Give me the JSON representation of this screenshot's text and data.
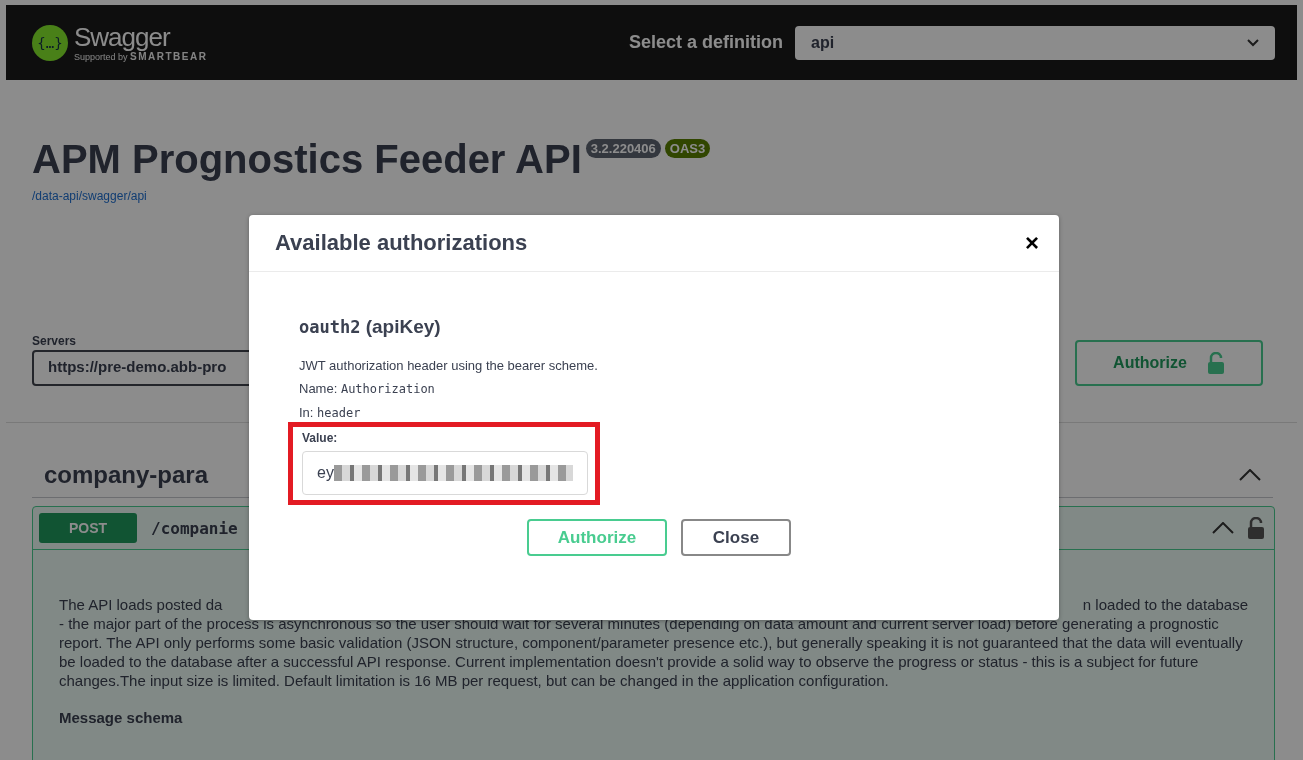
{
  "topbar": {
    "logo_glyph": "{…}",
    "logo_name": "Swagger",
    "logo_sub": "Supported by",
    "logo_brand": "SMARTBEAR",
    "definition_label": "Select a definition",
    "definition_value": "api"
  },
  "info": {
    "title": "APM Prognostics Feeder API",
    "version": "3.2.220406",
    "spec": "OAS3",
    "url": "/data-api/swagger/api"
  },
  "servers": {
    "label": "Servers",
    "value": "https://pre-demo.abb-pro",
    "authorize_button": "Authorize"
  },
  "section": {
    "title": "company-para",
    "expanded": true
  },
  "operation": {
    "method": "POST",
    "path": "/companie",
    "expanded": true,
    "description_left": "The API loads posted da",
    "description_right": "n loaded to the database",
    "description": "- the major part of the process is asynchronous so the user should wait for several minutes (depending on data amount and current server load) before generating a prognostic report. The API only performs some basic validation (JSON structure, component/parameter presence etc.), but generally speaking it is not guaranteed that the data will eventually be loaded to the database after a successful API response. Current implementation doesn't provide a solid way to observe the progress or status - this is a subject for future changes.The input size is limited. Default limitation is 16 MB per request, but can be changed in the application configuration.",
    "schema_heading": "Message schema"
  },
  "modal": {
    "title": "Available authorizations",
    "close": "×",
    "scheme_name": "oauth2",
    "scheme_type": "(apiKey)",
    "description": "JWT authorization header using the bearer scheme.",
    "name_label": "Name:",
    "name_value": "Authorization",
    "in_label": "In:",
    "in_value": "header",
    "value_label": "Value:",
    "value": "ey",
    "value_highlighted": true,
    "buttons": [
      {
        "label": "Authorize",
        "kind": "primary"
      },
      {
        "label": "Close",
        "kind": "secondary"
      }
    ]
  }
}
